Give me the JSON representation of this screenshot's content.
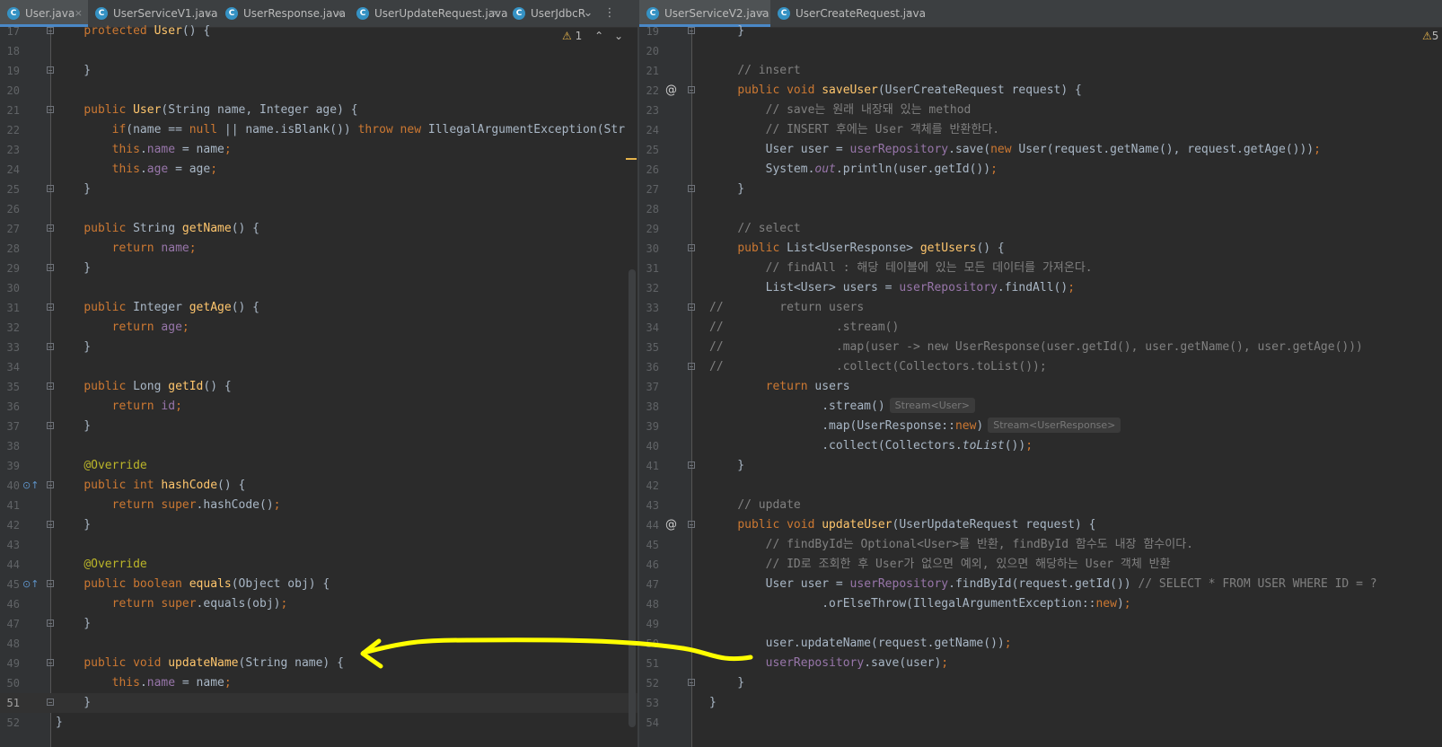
{
  "left_tabs": [
    {
      "name": "User.java",
      "active": true
    },
    {
      "name": "UserServiceV1.java",
      "active": false
    },
    {
      "name": "UserResponse.java",
      "active": false
    },
    {
      "name": "UserUpdateRequest.java",
      "active": false
    },
    {
      "name": "UserJdbcR",
      "active": false
    }
  ],
  "right_tabs": [
    {
      "name": "UserServiceV2.java",
      "active": true
    },
    {
      "name": "UserCreateRequest.java",
      "active": false
    }
  ],
  "tab_close_glyph": "×",
  "file_type_glyph": "C",
  "left_warning_count": "1",
  "right_warning_count": "5",
  "annotation_color": "#ffff00",
  "left_lines": [
    {
      "n": "17",
      "fold": true,
      "tokens": [
        [
          "    ",
          ""
        ],
        [
          "protected ",
          "kw"
        ],
        [
          "User",
          "fn"
        ],
        [
          "() {",
          ""
        ]
      ]
    },
    {
      "n": "18",
      "tokens": []
    },
    {
      "n": "19",
      "fold": true,
      "tokens": [
        [
          "    }",
          ""
        ]
      ]
    },
    {
      "n": "20",
      "tokens": []
    },
    {
      "n": "21",
      "fold": true,
      "tokens": [
        [
          "    ",
          ""
        ],
        [
          "public ",
          "kw"
        ],
        [
          "User",
          "fn"
        ],
        [
          "(String name, Integer age) {",
          ""
        ]
      ]
    },
    {
      "n": "22",
      "tokens": [
        [
          "        ",
          ""
        ],
        [
          "if",
          "kw"
        ],
        [
          "(name == ",
          ""
        ],
        [
          "null",
          "kw"
        ],
        [
          " || name.isBlank()) ",
          ""
        ],
        [
          "throw new ",
          "kw"
        ],
        [
          "IllegalArgumentException(Str",
          ""
        ]
      ]
    },
    {
      "n": "23",
      "tokens": [
        [
          "        ",
          ""
        ],
        [
          "this",
          "kw"
        ],
        [
          ".",
          ""
        ],
        [
          "name",
          "fld"
        ],
        [
          " = name",
          ""
        ],
        [
          ";",
          "kw"
        ]
      ]
    },
    {
      "n": "24",
      "tokens": [
        [
          "        ",
          ""
        ],
        [
          "this",
          "kw"
        ],
        [
          ".",
          ""
        ],
        [
          "age",
          "fld"
        ],
        [
          " = age",
          ""
        ],
        [
          ";",
          "kw"
        ]
      ]
    },
    {
      "n": "25",
      "fold": true,
      "tokens": [
        [
          "    }",
          ""
        ]
      ]
    },
    {
      "n": "26",
      "tokens": []
    },
    {
      "n": "27",
      "fold": true,
      "tokens": [
        [
          "    ",
          ""
        ],
        [
          "public ",
          "kw"
        ],
        [
          "String ",
          ""
        ],
        [
          "getName",
          "fn"
        ],
        [
          "() {",
          ""
        ]
      ]
    },
    {
      "n": "28",
      "tokens": [
        [
          "        ",
          ""
        ],
        [
          "return ",
          "kw"
        ],
        [
          "name",
          "fld"
        ],
        [
          ";",
          "kw"
        ]
      ]
    },
    {
      "n": "29",
      "fold": true,
      "tokens": [
        [
          "    }",
          ""
        ]
      ]
    },
    {
      "n": "30",
      "tokens": []
    },
    {
      "n": "31",
      "fold": true,
      "tokens": [
        [
          "    ",
          ""
        ],
        [
          "public ",
          "kw"
        ],
        [
          "Integer ",
          ""
        ],
        [
          "getAge",
          "fn"
        ],
        [
          "() {",
          ""
        ]
      ]
    },
    {
      "n": "32",
      "tokens": [
        [
          "        ",
          ""
        ],
        [
          "return ",
          "kw"
        ],
        [
          "age",
          "fld"
        ],
        [
          ";",
          "kw"
        ]
      ]
    },
    {
      "n": "33",
      "fold": true,
      "tokens": [
        [
          "    }",
          ""
        ]
      ]
    },
    {
      "n": "34",
      "tokens": []
    },
    {
      "n": "35",
      "fold": true,
      "tokens": [
        [
          "    ",
          ""
        ],
        [
          "public ",
          "kw"
        ],
        [
          "Long ",
          ""
        ],
        [
          "getId",
          "fn"
        ],
        [
          "() {",
          ""
        ]
      ]
    },
    {
      "n": "36",
      "tokens": [
        [
          "        ",
          ""
        ],
        [
          "return ",
          "kw"
        ],
        [
          "id",
          "fld"
        ],
        [
          ";",
          "kw"
        ]
      ]
    },
    {
      "n": "37",
      "fold": true,
      "tokens": [
        [
          "    }",
          ""
        ]
      ]
    },
    {
      "n": "38",
      "tokens": []
    },
    {
      "n": "39",
      "tokens": [
        [
          "    ",
          ""
        ],
        [
          "@Override",
          "an"
        ]
      ]
    },
    {
      "n": "40",
      "fold": true,
      "gicon": "override",
      "tokens": [
        [
          "    ",
          ""
        ],
        [
          "public int ",
          "kw"
        ],
        [
          "hashCode",
          "fn"
        ],
        [
          "() {",
          ""
        ]
      ]
    },
    {
      "n": "41",
      "tokens": [
        [
          "        ",
          ""
        ],
        [
          "return super",
          "kw"
        ],
        [
          ".hashCode()",
          ""
        ],
        [
          ";",
          "kw"
        ]
      ]
    },
    {
      "n": "42",
      "fold": true,
      "tokens": [
        [
          "    }",
          ""
        ]
      ]
    },
    {
      "n": "43",
      "tokens": []
    },
    {
      "n": "44",
      "tokens": [
        [
          "    ",
          ""
        ],
        [
          "@Override",
          "an"
        ]
      ]
    },
    {
      "n": "45",
      "fold": true,
      "gicon": "override",
      "tokens": [
        [
          "    ",
          ""
        ],
        [
          "public boolean ",
          "kw"
        ],
        [
          "equals",
          "fn"
        ],
        [
          "(Object obj) {",
          ""
        ]
      ]
    },
    {
      "n": "46",
      "tokens": [
        [
          "        ",
          ""
        ],
        [
          "return super",
          "kw"
        ],
        [
          ".equals(obj)",
          ""
        ],
        [
          ";",
          "kw"
        ]
      ]
    },
    {
      "n": "47",
      "fold": true,
      "tokens": [
        [
          "    }",
          ""
        ]
      ]
    },
    {
      "n": "48",
      "tokens": []
    },
    {
      "n": "49",
      "fold": true,
      "tokens": [
        [
          "    ",
          ""
        ],
        [
          "public void ",
          "kw"
        ],
        [
          "updateName",
          "fn"
        ],
        [
          "(String name) {",
          ""
        ]
      ]
    },
    {
      "n": "50",
      "tokens": [
        [
          "        ",
          ""
        ],
        [
          "this",
          "kw"
        ],
        [
          ".",
          ""
        ],
        [
          "name",
          "fld"
        ],
        [
          " = name",
          ""
        ],
        [
          ";",
          "kw"
        ]
      ]
    },
    {
      "n": "51",
      "fold": true,
      "current": true,
      "tokens": [
        [
          "    }",
          ""
        ]
      ]
    },
    {
      "n": "52",
      "tokens": [
        [
          "}",
          ""
        ]
      ]
    }
  ],
  "right_lines": [
    {
      "n": "19",
      "fold": true,
      "tokens": [
        [
          "    }",
          ""
        ]
      ]
    },
    {
      "n": "20",
      "tokens": []
    },
    {
      "n": "21",
      "tokens": [
        [
          "    ",
          ""
        ],
        [
          "// insert",
          "cm"
        ]
      ]
    },
    {
      "n": "22",
      "fold": true,
      "gicon": "at",
      "tokens": [
        [
          "    ",
          ""
        ],
        [
          "public void ",
          "kw"
        ],
        [
          "saveUser",
          "fn"
        ],
        [
          "(UserCreateRequest request) {",
          ""
        ]
      ]
    },
    {
      "n": "23",
      "tokens": [
        [
          "        ",
          ""
        ],
        [
          "// save는 원래 내장돼 있는 method",
          "cm"
        ]
      ]
    },
    {
      "n": "24",
      "tokens": [
        [
          "        ",
          ""
        ],
        [
          "// INSERT 후에는 User 객체를 반환한다.",
          "cm"
        ]
      ]
    },
    {
      "n": "25",
      "tokens": [
        [
          "        User user = ",
          ""
        ],
        [
          "userRepository",
          "fld"
        ],
        [
          ".save(",
          ""
        ],
        [
          "new ",
          "kw"
        ],
        [
          "User(request.getName(), request.getAge()))",
          ""
        ],
        [
          ";",
          "kw"
        ]
      ]
    },
    {
      "n": "26",
      "tokens": [
        [
          "        System.",
          ""
        ],
        [
          "out",
          "st"
        ],
        [
          ".println(user.getId())",
          ""
        ],
        [
          ";",
          "kw"
        ]
      ]
    },
    {
      "n": "27",
      "fold": true,
      "tokens": [
        [
          "    }",
          ""
        ]
      ]
    },
    {
      "n": "28",
      "tokens": []
    },
    {
      "n": "29",
      "tokens": [
        [
          "    ",
          ""
        ],
        [
          "// select",
          "cm"
        ]
      ]
    },
    {
      "n": "30",
      "fold": true,
      "tokens": [
        [
          "    ",
          ""
        ],
        [
          "public ",
          "kw"
        ],
        [
          "List<UserResponse> ",
          ""
        ],
        [
          "getUsers",
          "fn"
        ],
        [
          "() {",
          ""
        ]
      ]
    },
    {
      "n": "31",
      "tokens": [
        [
          "        ",
          ""
        ],
        [
          "// findAll : 해당 테이블에 있는 모든 데이터를 가져온다.",
          "cm"
        ]
      ]
    },
    {
      "n": "32",
      "tokens": [
        [
          "        List<User> users = ",
          ""
        ],
        [
          "userRepository",
          "fld"
        ],
        [
          ".findAll()",
          ""
        ],
        [
          ";",
          "kw"
        ]
      ]
    },
    {
      "n": "33",
      "fold": true,
      "tokens": [
        [
          "//",
          "cm"
        ],
        [
          "        return users",
          "cm"
        ]
      ]
    },
    {
      "n": "34",
      "tokens": [
        [
          "//",
          "cm"
        ],
        [
          "                .stream()",
          "cm"
        ]
      ]
    },
    {
      "n": "35",
      "tokens": [
        [
          "//",
          "cm"
        ],
        [
          "                .map(user -> new UserResponse(user.getId(), user.getName(), user.getAge()))",
          "cm"
        ]
      ]
    },
    {
      "n": "36",
      "fold": true,
      "tokens": [
        [
          "//",
          "cm"
        ],
        [
          "                .collect(Collectors.toList());",
          "cm"
        ]
      ]
    },
    {
      "n": "37",
      "tokens": [
        [
          "        ",
          ""
        ],
        [
          "return ",
          "kw"
        ],
        [
          "users",
          ""
        ]
      ]
    },
    {
      "n": "38",
      "hint": "Stream<User>",
      "tokens": [
        [
          "                .stream()",
          ""
        ]
      ]
    },
    {
      "n": "39",
      "hint": "Stream<UserResponse>",
      "tokens": [
        [
          "                .map(UserResponse::",
          ""
        ],
        [
          "new",
          "kw"
        ],
        [
          ")",
          ""
        ]
      ]
    },
    {
      "n": "40",
      "tokens": [
        [
          "                .collect(Collectors.",
          ""
        ],
        [
          "toList",
          "it"
        ],
        [
          "())",
          ""
        ],
        [
          ";",
          "kw"
        ]
      ]
    },
    {
      "n": "41",
      "fold": true,
      "tokens": [
        [
          "    }",
          ""
        ]
      ]
    },
    {
      "n": "42",
      "tokens": []
    },
    {
      "n": "43",
      "tokens": [
        [
          "    ",
          ""
        ],
        [
          "// update",
          "cm"
        ]
      ]
    },
    {
      "n": "44",
      "fold": true,
      "gicon": "at",
      "tokens": [
        [
          "    ",
          ""
        ],
        [
          "public void ",
          "kw"
        ],
        [
          "updateUser",
          "fn"
        ],
        [
          "(UserUpdateRequest request) {",
          ""
        ]
      ]
    },
    {
      "n": "45",
      "tokens": [
        [
          "        ",
          ""
        ],
        [
          "// findById는 Optional<User>를 반환, findById 함수도 내장 함수이다.",
          "cm"
        ]
      ]
    },
    {
      "n": "46",
      "tokens": [
        [
          "        ",
          ""
        ],
        [
          "// ID로 조회한 후 User가 없으면 예외, 있으면 해당하는 User 객체 반환",
          "cm"
        ]
      ]
    },
    {
      "n": "47",
      "tokens": [
        [
          "        User user = ",
          ""
        ],
        [
          "userRepository",
          "fld"
        ],
        [
          ".findById(request.getId()) ",
          ""
        ],
        [
          "// SELECT * FROM USER WHERE ID = ?",
          "cm"
        ]
      ]
    },
    {
      "n": "48",
      "tokens": [
        [
          "                .orElseThrow(IllegalArgumentException::",
          ""
        ],
        [
          "new",
          "kw"
        ],
        [
          ")",
          ""
        ],
        [
          ";",
          "kw"
        ]
      ]
    },
    {
      "n": "49",
      "tokens": []
    },
    {
      "n": "50",
      "tokens": [
        [
          "        user.updateName(request.getName())",
          ""
        ],
        [
          ";",
          "kw"
        ]
      ]
    },
    {
      "n": "51",
      "tokens": [
        [
          "        ",
          ""
        ],
        [
          "userRepository",
          "fld"
        ],
        [
          ".save(user)",
          ""
        ],
        [
          ";",
          "kw"
        ]
      ]
    },
    {
      "n": "52",
      "fold": true,
      "tokens": [
        [
          "    }",
          ""
        ]
      ]
    },
    {
      "n": "53",
      "tokens": [
        [
          "}",
          ""
        ]
      ]
    },
    {
      "n": "54",
      "tokens": []
    }
  ]
}
